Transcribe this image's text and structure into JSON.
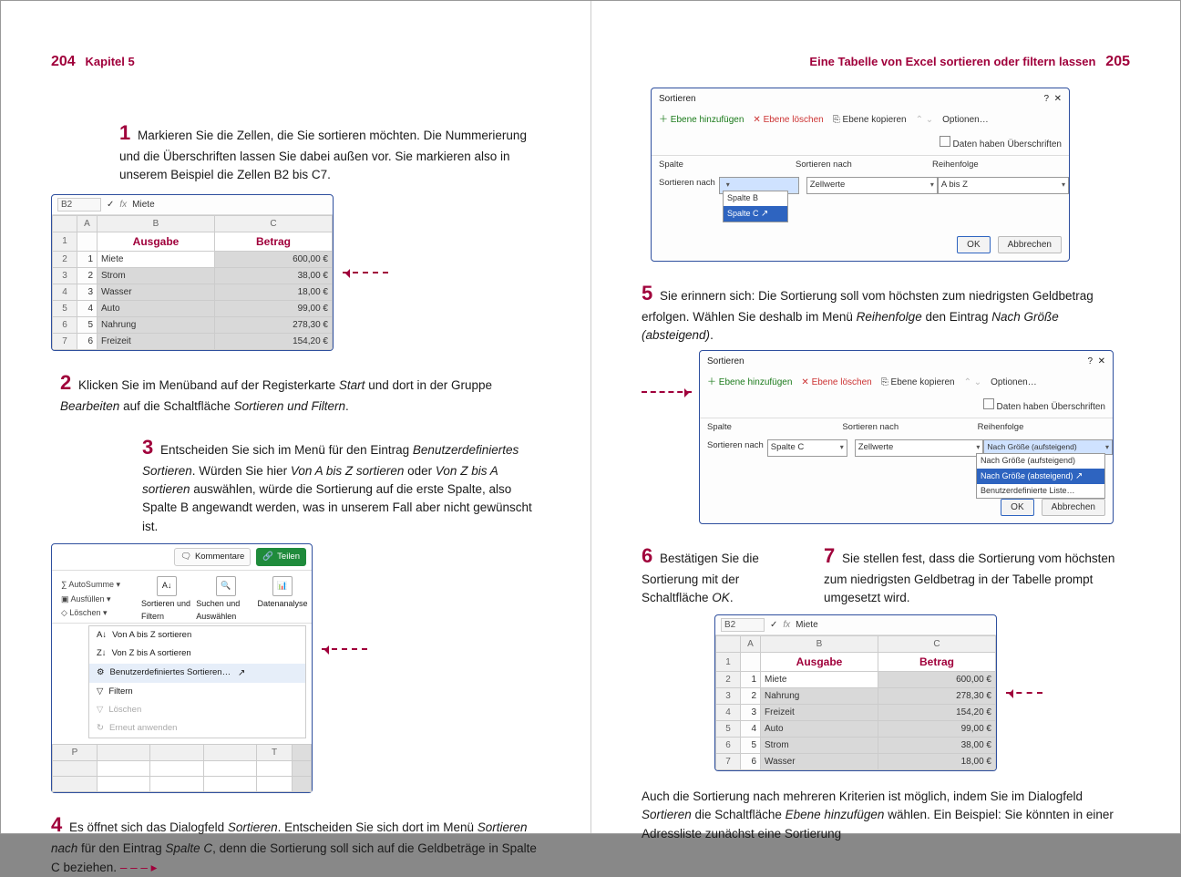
{
  "left": {
    "page_number": "204",
    "chapter": "Kapitel 5",
    "step1": {
      "num": "1",
      "text": "Markieren Sie die Zellen, die Sie sortieren möchten. Die Nummerierung und die Überschriften lassen Sie dabei außen vor. Sie markieren also in unserem Beispiel die Zellen B2 bis C7."
    },
    "fig1": {
      "cell_ref": "B2",
      "fx_value": "Miete",
      "col_labels": [
        "A",
        "B",
        "C"
      ],
      "header_b": "Ausgabe",
      "header_c": "Betrag",
      "rows": [
        {
          "n": "1",
          "a": "",
          "b": "",
          "c": ""
        },
        {
          "n": "2",
          "a": "1",
          "b": "Miete",
          "c": "600,00 €"
        },
        {
          "n": "3",
          "a": "2",
          "b": "Strom",
          "c": "38,00 €"
        },
        {
          "n": "4",
          "a": "3",
          "b": "Wasser",
          "c": "18,00 €"
        },
        {
          "n": "5",
          "a": "4",
          "b": "Auto",
          "c": "99,00 €"
        },
        {
          "n": "6",
          "a": "5",
          "b": "Nahrung",
          "c": "278,30 €"
        },
        {
          "n": "7",
          "a": "6",
          "b": "Freizeit",
          "c": "154,20 €"
        }
      ]
    },
    "step2": {
      "num": "2",
      "t1": "Klicken Sie im Menüband auf der Registerkarte ",
      "i1": "Start",
      "t2": " und dort in der Gruppe ",
      "i2": "Bearbeiten",
      "t3": " auf die Schaltfläche ",
      "i3": "Sortieren und Filtern",
      "t4": "."
    },
    "step3": {
      "num": "3",
      "t1": "Entscheiden Sie sich im Menü für den Eintrag ",
      "i1": "Benutzerdefiniertes Sortieren",
      "t2": ". Würden Sie hier ",
      "i2": "Von A bis Z sortieren",
      "t3": " oder ",
      "i3": "Von Z bis A sortieren",
      "t4": " auswählen, würde die Sortierung auf die erste Spalte, also Spalte B angewandt werden, was in unserem Fall aber nicht gewünscht ist."
    },
    "fig2": {
      "kommentare": "Kommentare",
      "teilen": "Teilen",
      "autosumme": "AutoSumme",
      "ausfuellen": "Ausfüllen",
      "loeschen": "Löschen",
      "sort_filter": "Sortieren und Filtern",
      "suchen": "Suchen und Auswählen",
      "daten": "Datenanalyse",
      "m1": "Von A bis Z sortieren",
      "m2": "Von Z bis A sortieren",
      "m3": "Benutzerdefiniertes Sortieren…",
      "m4": "Filtern",
      "m5": "Löschen",
      "m6": "Erneut anwenden",
      "cols": [
        "P",
        "",
        "",
        "",
        "T"
      ]
    },
    "step4": {
      "num": "4",
      "t1": "Es öffnet sich das Dialogfeld ",
      "i1": "Sortieren",
      "t2": ". Entscheiden Sie sich dort im Menü ",
      "i2": "Sortieren nach",
      "t3": " für den Eintrag ",
      "i3": "Spalte C",
      "t4": ", denn die Sortierung soll sich auf die Geldbeträge in Spalte C beziehen."
    }
  },
  "right": {
    "page_number": "205",
    "heading": "Eine Tabelle von Excel sortieren oder filtern lassen",
    "dlg_common": {
      "title": "Sortieren",
      "add": "Ebene hinzufügen",
      "del": "Ebene löschen",
      "copy": "Ebene kopieren",
      "opt": "Optionen…",
      "chk": "Daten haben Überschriften",
      "col_spalte": "Spalte",
      "col_sort": "Sortieren nach",
      "col_reih": "Reihenfolge",
      "sortnach": "Sortieren nach",
      "zellwerte": "Zellwerte",
      "abisz": "A bis Z",
      "ok": "OK",
      "cancel": "Abbrechen"
    },
    "dlg1": {
      "ddvalue": "",
      "opt1": "Spalte B",
      "opt2": "Spalte C"
    },
    "step5": {
      "num": "5",
      "t1": "Sie erinnern sich: Die Sortierung soll vom höchsten zum niedrigsten Geldbetrag erfolgen. Wählen Sie deshalb im Menü ",
      "i1": "Reihenfolge",
      "t2": " den Eintrag ",
      "i2": "Nach Größe (absteigend)",
      "t3": "."
    },
    "dlg2": {
      "spaltec": "Spalte C",
      "reih_cur": "Nach Größe (aufsteigend)",
      "o1": "Nach Größe (aufsteigend)",
      "o2": "Nach Größe (absteigend)",
      "o3": "Benutzerdefinierte Liste…"
    },
    "step6": {
      "num": "6",
      "t1": "Bestätigen Sie die Sortierung mit der Schaltfläche ",
      "i1": "OK",
      "t2": "."
    },
    "step7": {
      "num": "7",
      "t1": "Sie stellen fest, dass die Sortierung vom höchsten zum niedrigsten Geldbetrag in der Tabelle prompt umgesetzt wird."
    },
    "fig3": {
      "cell_ref": "B2",
      "fx_value": "Miete",
      "col_labels": [
        "A",
        "B",
        "C"
      ],
      "header_b": "Ausgabe",
      "header_c": "Betrag",
      "rows": [
        {
          "n": "1",
          "a": "",
          "b": "",
          "c": ""
        },
        {
          "n": "2",
          "a": "1",
          "b": "Miete",
          "c": "600,00 €"
        },
        {
          "n": "3",
          "a": "2",
          "b": "Nahrung",
          "c": "278,30 €"
        },
        {
          "n": "4",
          "a": "3",
          "b": "Freizeit",
          "c": "154,20 €"
        },
        {
          "n": "5",
          "a": "4",
          "b": "Auto",
          "c": "99,00 €"
        },
        {
          "n": "6",
          "a": "5",
          "b": "Strom",
          "c": "38,00 €"
        },
        {
          "n": "7",
          "a": "6",
          "b": "Wasser",
          "c": "18,00 €"
        }
      ]
    },
    "closing": {
      "t1": "Auch die Sortierung nach mehreren Kriterien ist möglich, indem Sie im Dialogfeld ",
      "i1": "Sortieren",
      "t2": " die Schaltfläche ",
      "i2": "Ebene hinzufügen",
      "t3": " wählen. Ein Beispiel: Sie könnten in einer Adressliste zunächst eine Sortierung"
    }
  }
}
